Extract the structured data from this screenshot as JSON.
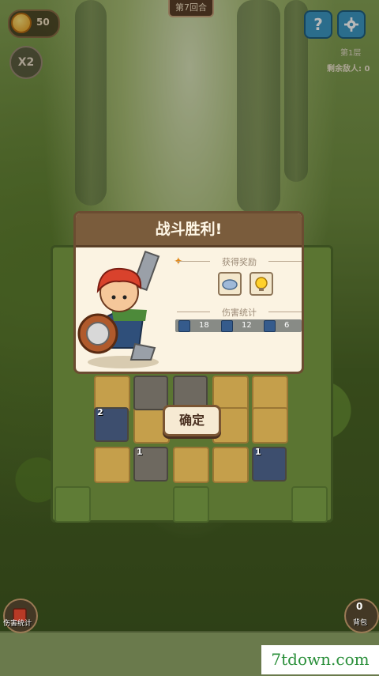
{
  "hud": {
    "round_label": "第7回合",
    "coins": "50",
    "speed": "X2",
    "help_icon": "?",
    "floor_label": "第1层",
    "enemies_label": "剩余敌人: 0"
  },
  "modal": {
    "title": "战斗胜利!",
    "reward_section": "获得奖励",
    "damage_section": "伤害统计",
    "stats": [
      "18",
      "12",
      "6"
    ],
    "reward_icons": [
      "cloud-badge-icon",
      "lightbulb-badge-icon"
    ]
  },
  "board": {
    "confirm_label": "确定",
    "piece_levels": [
      "2",
      "1",
      "1"
    ]
  },
  "bottom": {
    "damage_label": "伤害统计",
    "bag_label": "背包",
    "bag_count": "0"
  },
  "watermark": "7tdown.com"
}
